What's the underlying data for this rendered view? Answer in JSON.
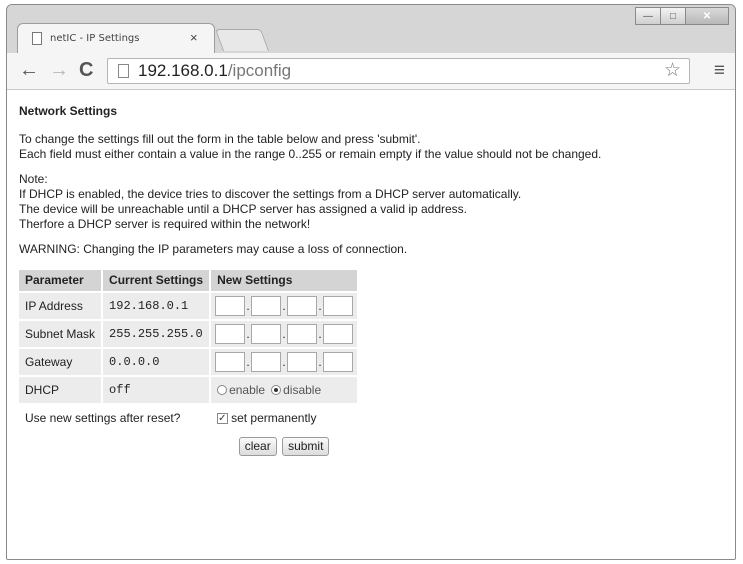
{
  "browser": {
    "tab_title": "netIC - IP Settings",
    "tab_close": "×",
    "url_host": "192.168.0.1",
    "url_path": "/ipconfig",
    "icons": [
      "back-arrow-icon",
      "forward-arrow-icon",
      "reload-icon",
      "document-icon",
      "star-icon",
      "menu-icon",
      "minimize-icon",
      "maximize-icon",
      "close-icon"
    ]
  },
  "page": {
    "title": "Network Settings",
    "intro": [
      "To change the settings fill out the form in the table below and press 'submit'.",
      "Each field must either contain a value in the range 0..255 or remain empty if the value should not be changed."
    ],
    "note": [
      "Note:",
      "If DHCP is enabled, the device tries to discover the settings from a DHCP server automatically.",
      "The device will be unreachable until a DHCP server has assigned a valid ip address.",
      "Therfore a DHCP server is required within the network!"
    ],
    "warning": "WARNING: Changing the IP parameters may cause a loss of connection."
  },
  "table": {
    "headers": [
      "Parameter",
      "Current Settings",
      "New Settings"
    ],
    "rows": [
      {
        "param": "IP Address",
        "current": "192.168.0.1"
      },
      {
        "param": "Subnet Mask",
        "current": "255.255.255.0"
      },
      {
        "param": "Gateway",
        "current": "0.0.0.0"
      },
      {
        "param": "DHCP",
        "current": "off"
      }
    ],
    "dhcp_enable_label": "enable",
    "dhcp_disable_label": "disable",
    "dhcp_selected": "disable",
    "reset_question": "Use new settings after reset?",
    "permanent_label": "set permanently",
    "permanent_checked": true,
    "octet_separator": "."
  },
  "buttons": {
    "clear": "clear",
    "submit": "submit"
  }
}
